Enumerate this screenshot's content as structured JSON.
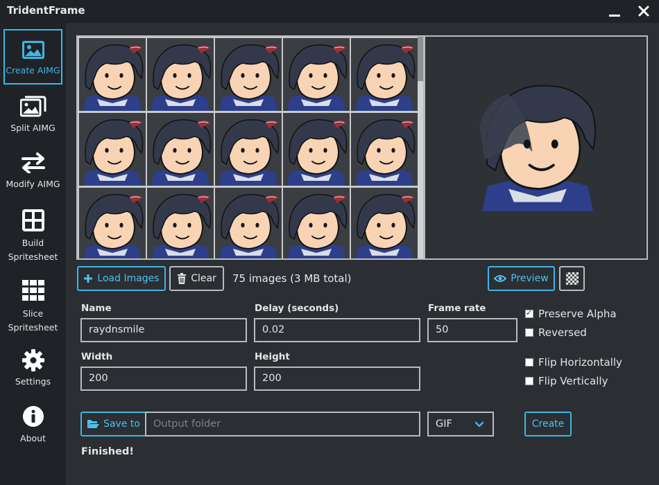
{
  "window": {
    "title": "TridentFrame"
  },
  "sidebar": {
    "items": [
      {
        "label": "Create AIMG",
        "icon": "image-icon"
      },
      {
        "label": "Split AIMG",
        "icon": "images-icon"
      },
      {
        "label": "Modify AIMG",
        "icon": "swap-arrows-icon"
      },
      {
        "label": "Build Spritesheet",
        "icon": "grid-2x2-icon"
      },
      {
        "label": "Slice Spritesheet",
        "icon": "grid-3x3-icon"
      },
      {
        "label": "Settings",
        "icon": "gear-icon"
      },
      {
        "label": "About",
        "icon": "info-icon"
      }
    ]
  },
  "toolbar": {
    "load_label": "Load Images",
    "clear_label": "Clear",
    "count_text": "75 images (3 MB total)",
    "preview_label": "Preview"
  },
  "form": {
    "name_label": "Name",
    "name_value": "raydnsmile",
    "delay_label": "Delay (seconds)",
    "delay_value": "0.02",
    "framerate_label": "Frame rate",
    "framerate_value": "50",
    "width_label": "Width",
    "width_value": "200",
    "height_label": "Height",
    "height_value": "200",
    "preserve_alpha": "Preserve Alpha",
    "reversed": "Reversed",
    "flip_h": "Flip Horizontally",
    "flip_v": "Flip Vertically",
    "checks": {
      "preserve_alpha": true,
      "reversed": false,
      "flip_h": false,
      "flip_v": false
    }
  },
  "output": {
    "save_label": "Save to",
    "folder_placeholder": "Output folder",
    "format_value": "GIF",
    "create_label": "Create"
  },
  "status": {
    "text": "Finished!"
  },
  "colors": {
    "accent": "#3fb6e6",
    "background": "#2b2e33",
    "sidebar": "#1f2226"
  }
}
